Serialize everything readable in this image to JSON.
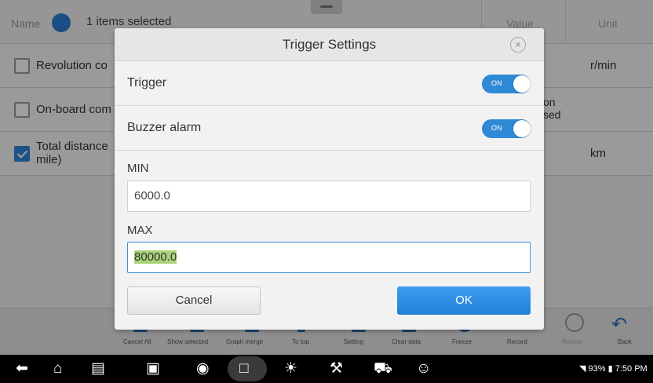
{
  "background": {
    "header": {
      "name_label": "Name",
      "selected_text": "1 items selected",
      "col_value": "Value",
      "col_unit": "Unit"
    },
    "rows": [
      {
        "label": "Revolution co",
        "unit": "r/min",
        "value": "",
        "checked": false
      },
      {
        "label": "On-board com",
        "unit": "",
        "value": "on\nsed",
        "checked": false
      },
      {
        "label": "Total distance mile)",
        "unit": "km",
        "value": "",
        "checked": true
      }
    ],
    "toolbar": [
      "Cancel All",
      "Show selected",
      "Graph merge",
      "To top",
      "Setting",
      "Clear data",
      "Freeze",
      "Record",
      "Review",
      "Back"
    ]
  },
  "dialog": {
    "title": "Trigger Settings",
    "close_icon": "×",
    "trigger_label": "Trigger",
    "trigger_state": "ON",
    "buzzer_label": "Buzzer alarm",
    "buzzer_state": "ON",
    "min_label": "MIN",
    "min_value": "6000.0",
    "max_label": "MAX",
    "max_value": "80000.0",
    "cancel_label": "Cancel",
    "ok_label": "OK"
  },
  "system_bar": {
    "battery": "93%",
    "time": "7:50 PM",
    "icons": [
      "back-icon",
      "home-icon",
      "vci-icon",
      "recent-apps-icon",
      "browser-icon",
      "screen-capture-icon",
      "brightness-icon",
      "manager-icon",
      "vehicle-icon",
      "user-icon"
    ]
  },
  "colors": {
    "accent": "#2f8ad6",
    "highlight": "#a9d37a"
  }
}
